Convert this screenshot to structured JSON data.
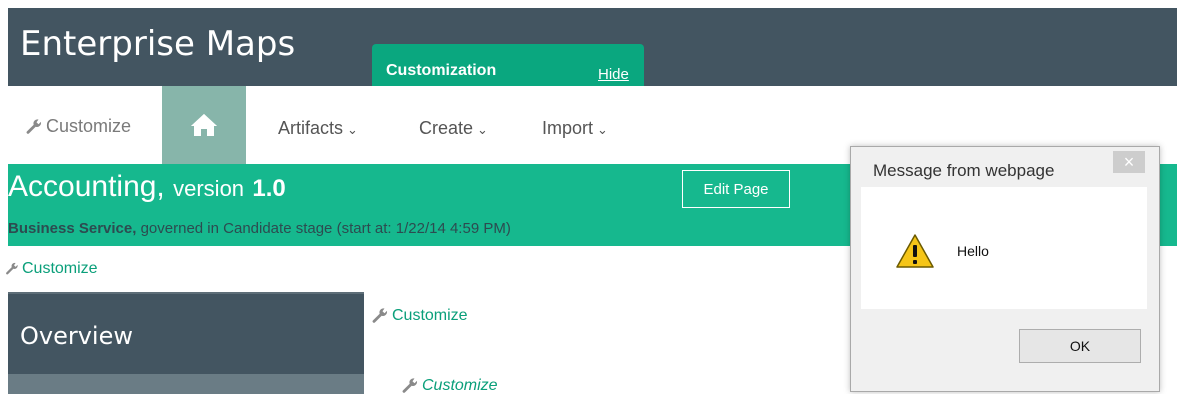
{
  "header": {
    "app_title": "Enterprise Maps"
  },
  "customization_popup": {
    "title": "Customization",
    "hide_label": "Hide"
  },
  "nav": {
    "customize_label": "Customize",
    "home_icon": "home-icon",
    "items": [
      {
        "label": "Artifacts"
      },
      {
        "label": "Create"
      },
      {
        "label": "Import"
      }
    ]
  },
  "banner": {
    "name": "Accounting,",
    "version_label": "version",
    "version_number": "1.0",
    "type_label": "Business Service,",
    "stage_text": "governed in Candidate stage (start at: 1/22/14 4:59 PM)",
    "edit_button": "Edit Page"
  },
  "customize_links": [
    {
      "label": "Customize"
    },
    {
      "label": "Customize"
    },
    {
      "label": "Customize"
    }
  ],
  "overview": {
    "label": "Overview"
  },
  "dialog": {
    "title": "Message from webpage",
    "close_label": "×",
    "message": "Hello",
    "ok_label": "OK",
    "icon": "warning-icon"
  },
  "colors": {
    "header_bg": "#435561",
    "accent_green": "#16b88e",
    "popup_green": "#0aa77f",
    "link_green": "#0a9f7a",
    "home_tile": "#87b5aa"
  }
}
